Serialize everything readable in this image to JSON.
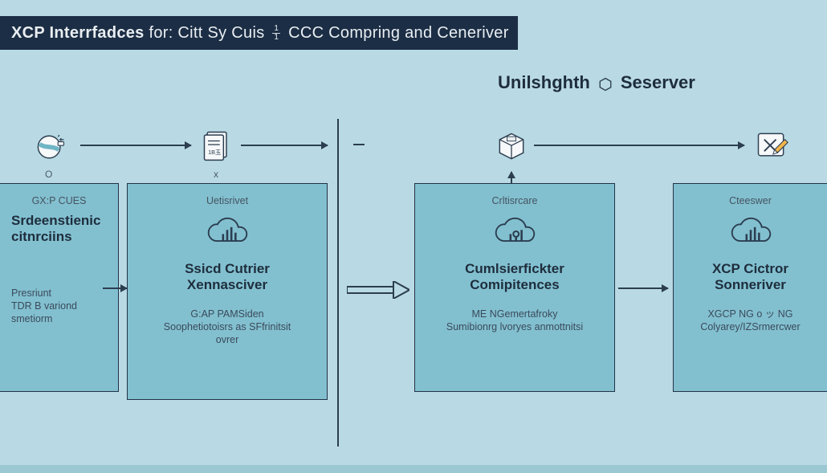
{
  "header": {
    "prefix_bold": "XCP Interrfadces",
    "mid": " for: Citt Sy Cuis ",
    "frac_top": "1",
    "frac_bottom": "1",
    "suffix": " CCC Compring and Ceneriver"
  },
  "subheader": {
    "left": "Unilshghth",
    "right": "Seserver"
  },
  "icon_row": {
    "a_caption": "O",
    "b_caption": "x"
  },
  "boxes": {
    "a": {
      "top_label": "GX:P CUES",
      "title_l1": "Srdeenstienic",
      "title_l2": "citnrciins",
      "sub_l1": "Presriunt",
      "sub_l2": "TDR B variond",
      "sub_l3": "smetiorm"
    },
    "b": {
      "top_label": "Uetisrivet",
      "title_l1": "Ssicd Cutrier",
      "title_l2": "Xennasciver",
      "sub_l1": "G:AP PAMSiden ",
      "sub_l2": "Soophetiotoisrs as SFfrinitsit",
      "sub_l3": "ovrer"
    },
    "c": {
      "top_label": "Crltisrcare",
      "title_l1": "Cumlsierfickter",
      "title_l2": "Comipitences",
      "sub_l1": "ME NGemertafroky",
      "sub_l2": "Sumibionrg lvoryes anmottnitsi"
    },
    "d": {
      "top_label": "Cteeswer",
      "title_l1": "XCP Cictror",
      "title_l2": "Sonneriver",
      "sub_l1": "XGCP NG o ッ NG",
      "sub_l2": "Colyarey/IZSrmercwer"
    }
  }
}
